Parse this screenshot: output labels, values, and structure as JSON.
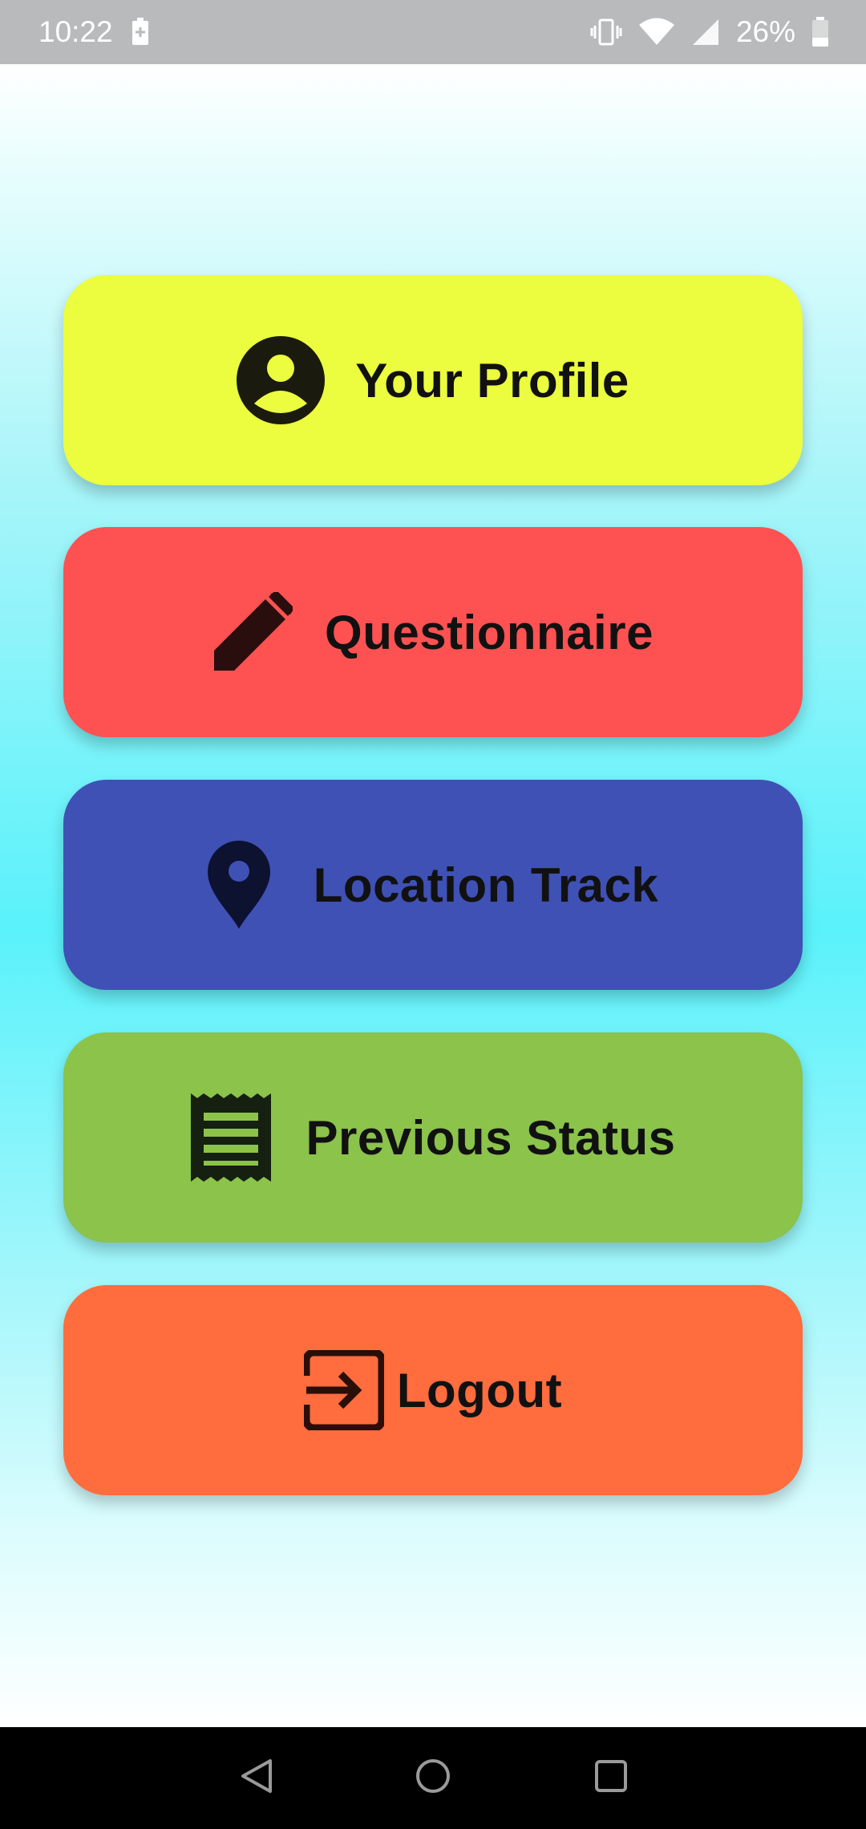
{
  "status_bar": {
    "time": "10:22",
    "battery_percent": "26%",
    "icons": [
      "battery-saver-icon",
      "vibrate-icon",
      "wifi-icon",
      "cell-signal-icon",
      "battery-icon"
    ]
  },
  "menu": {
    "items": [
      {
        "label": "Your Profile",
        "icon": "account-circle-icon",
        "color": "#ebfd3e"
      },
      {
        "label": "Questionnaire",
        "icon": "pencil-icon",
        "color": "#fe5252"
      },
      {
        "label": "Location Track",
        "icon": "map-pin-icon",
        "color": "#3f51b5"
      },
      {
        "label": "Previous Status",
        "icon": "receipt-icon",
        "color": "#8bc34b"
      },
      {
        "label": "Logout",
        "icon": "exit-icon",
        "color": "#ff6c3e"
      }
    ]
  },
  "nav_bar": {
    "buttons": [
      "back-icon",
      "home-icon",
      "recents-icon"
    ]
  },
  "colors": {
    "status_bar_bg": "#b8babb",
    "icon_dark": "#1a1a0f"
  }
}
